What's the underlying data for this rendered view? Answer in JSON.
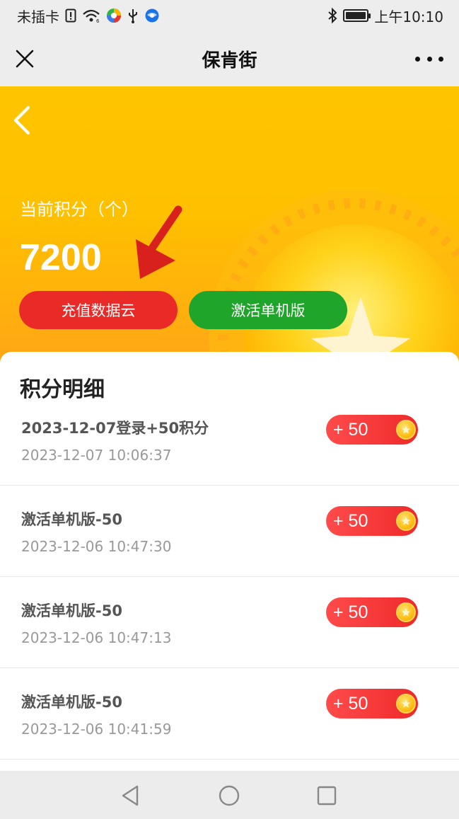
{
  "status_bar": {
    "carrier": "未插卡",
    "time": "上午10:10"
  },
  "header": {
    "title": "保肯街"
  },
  "hero": {
    "points_label": "当前积分（个）",
    "points_value": "7200",
    "recharge_button": "充值数据云",
    "activate_button": "激活单机版"
  },
  "details": {
    "title": "积分明细",
    "records": [
      {
        "title": "2023-12-07登录+50积分",
        "time": "2023-12-07 10:06:37",
        "amount": "+ 50"
      },
      {
        "title": "激活单机版-50",
        "time": "2023-12-06 10:47:30",
        "amount": "+ 50"
      },
      {
        "title": "激活单机版-50",
        "time": "2023-12-06 10:47:13",
        "amount": "+ 50"
      },
      {
        "title": "激活单机版-50",
        "time": "2023-12-06 10:41:59",
        "amount": "+ 50"
      }
    ]
  },
  "icons": {
    "close": "close-icon",
    "more": "more-dots-icon",
    "back": "chevron-left-icon",
    "coin": "coin-star-icon",
    "nav_back": "triangle-back-icon",
    "nav_home": "circle-home-icon",
    "nav_recent": "square-recent-icon"
  },
  "colors": {
    "hero_yellow": "#ffc400",
    "recharge_red": "#ea2a27",
    "activate_green": "#1ea52a",
    "badge_red": "#ff4b4b",
    "arrow_red": "#d8201c"
  }
}
